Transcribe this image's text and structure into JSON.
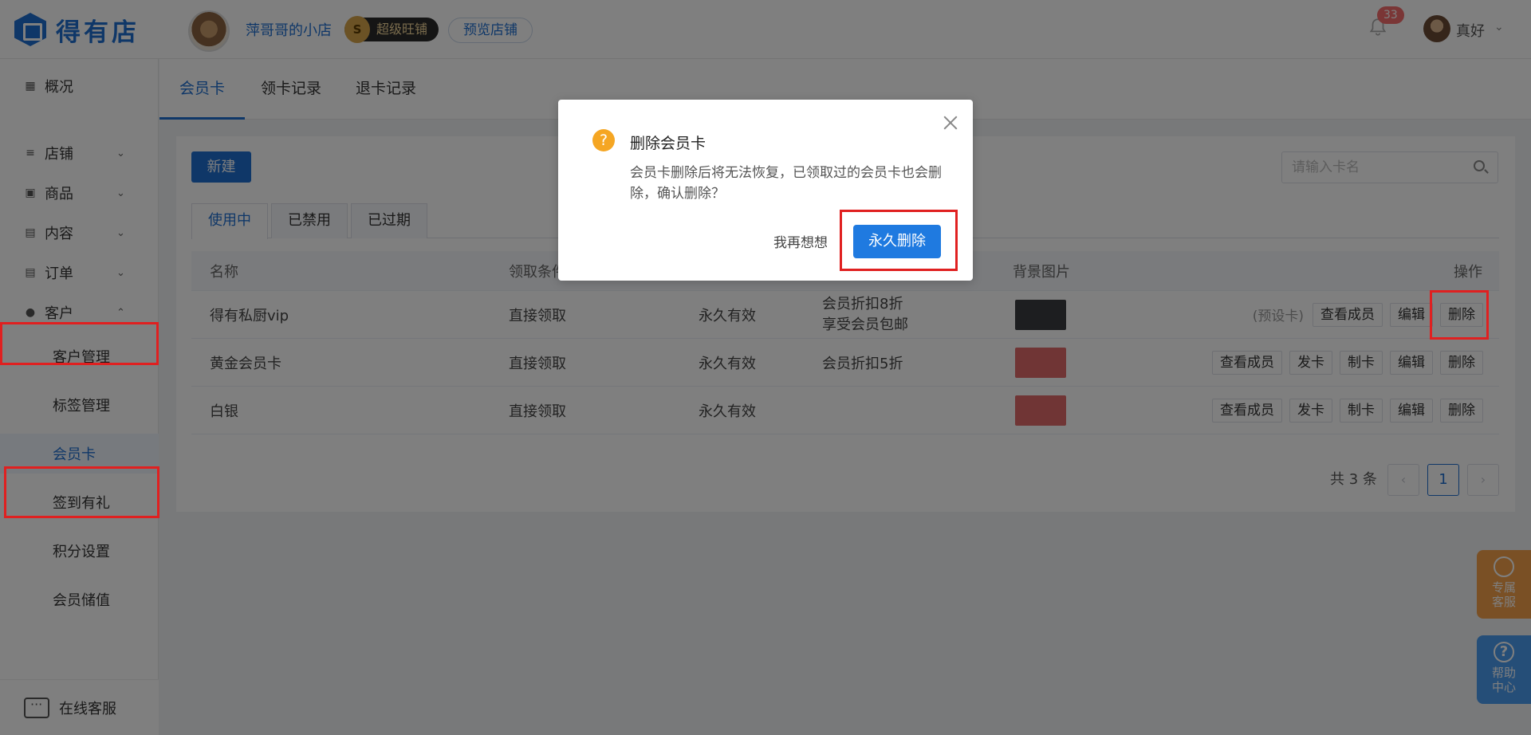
{
  "header": {
    "logo_text": "得有店",
    "shop_name": "萍哥哥的小店",
    "vip_coin": "S",
    "vip_label": "超级旺铺",
    "preview_label": "预览店铺",
    "notification_count": "33",
    "user_name": "真好"
  },
  "sidebar": {
    "items": [
      {
        "label": "概况"
      },
      {
        "label": "店铺"
      },
      {
        "label": "商品"
      },
      {
        "label": "内容"
      },
      {
        "label": "订单"
      },
      {
        "label": "客户"
      }
    ],
    "sub_items": [
      {
        "label": "客户管理"
      },
      {
        "label": "标签管理"
      },
      {
        "label": "会员卡"
      },
      {
        "label": "签到有礼"
      },
      {
        "label": "积分设置"
      },
      {
        "label": "会员储值"
      }
    ],
    "footer_label": "在线客服"
  },
  "tabs": [
    {
      "label": "会员卡"
    },
    {
      "label": "领卡记录"
    },
    {
      "label": "退卡记录"
    }
  ],
  "toolbar": {
    "new_label": "新建",
    "search_placeholder": "请输入卡名"
  },
  "status_tabs": [
    {
      "label": "使用中"
    },
    {
      "label": "已禁用"
    },
    {
      "label": "已过期"
    }
  ],
  "table": {
    "headers": {
      "name": "名称",
      "condition": "领取条件",
      "bg": "背景图片",
      "ops": "操作"
    },
    "rows": [
      {
        "name": "得有私厨vip",
        "condition": "直接领取",
        "validity": "永久有效",
        "rights": [
          "会员折扣8折",
          "享受会员包邮"
        ],
        "bg_color": "#3b3d40",
        "note": "(预设卡)",
        "ops": [
          "查看成员",
          "编辑",
          "删除"
        ]
      },
      {
        "name": "黄金会员卡",
        "condition": "直接领取",
        "validity": "永久有效",
        "rights": [
          "会员折扣5折"
        ],
        "bg_color": "#e06a6a",
        "ops": [
          "查看成员",
          "发卡",
          "制卡",
          "编辑",
          "删除"
        ]
      },
      {
        "name": "白银",
        "condition": "直接领取",
        "validity": "永久有效",
        "rights": [],
        "bg_color": "#e06a6a",
        "ops": [
          "查看成员",
          "发卡",
          "制卡",
          "编辑",
          "删除"
        ]
      }
    ]
  },
  "pagination": {
    "total_label": "共 3 条",
    "prev": "‹",
    "current": "1",
    "next": "›"
  },
  "float_buttons": {
    "service": "专属客服",
    "help": "帮助中心",
    "help_icon": "?"
  },
  "modal": {
    "icon": "?",
    "title": "删除会员卡",
    "body": "会员卡删除后将无法恢复，已领取过的会员卡也会删除，确认删除？",
    "cancel_label": "我再想想",
    "confirm_label": "永久删除"
  },
  "colors": {
    "primary": "#1f6fd1",
    "highlight": "#e02020",
    "warning": "#f5a623",
    "badge": "#f56c6c"
  }
}
